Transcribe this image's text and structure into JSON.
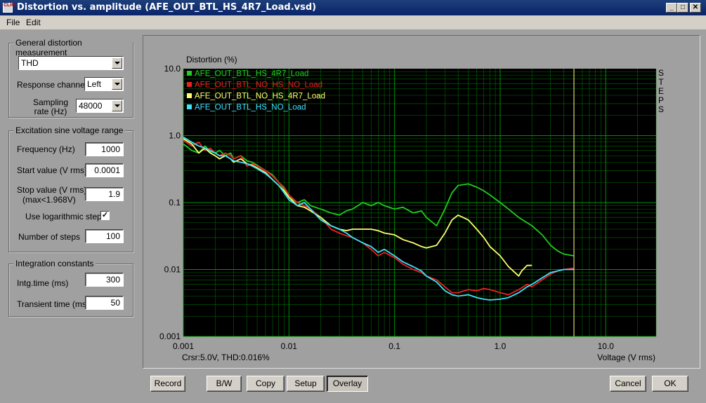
{
  "window": {
    "title": "Distortion vs. amplitude (AFE_OUT_BTL_HS_4R7_Load.vsd)",
    "icon_label": "CLIO",
    "controls": [
      "minimize-icon",
      "maximize-icon",
      "close-icon"
    ]
  },
  "menu": {
    "file": "File",
    "edit": "Edit"
  },
  "general": {
    "title": "General distortion measurement",
    "measurement": "THD",
    "response_channel_label": "Response channel",
    "response_channel": "Left",
    "sampling_label_1": "Sampling",
    "sampling_label_2": "rate (Hz)",
    "sampling_rate": "48000"
  },
  "excitation": {
    "title": "Excitation sine voltage range",
    "frequency_label": "Frequency (Hz)",
    "frequency": "1000",
    "start_label": "Start value (V rms)",
    "start": "0.0001",
    "stop_label_1": "Stop value (V rms)",
    "stop_label_2": "(max<1.968V)",
    "stop": "1.9",
    "log_label": "Use logarithmic steps",
    "log_checked": "✓",
    "steps_label": "Number of steps",
    "steps": "100"
  },
  "integration": {
    "title": "Integration constants",
    "intg_label": "Intg.time (ms)",
    "intg": "300",
    "transient_label": "Transient time (ms)",
    "transient": "50"
  },
  "buttons": {
    "record": "Record",
    "bw": "B/W",
    "copy": "Copy",
    "setup": "Setup",
    "overlay": "Overlay",
    "cancel": "Cancel",
    "ok": "OK"
  },
  "chart_data": {
    "type": "line",
    "ylabel": "Distortion (%)",
    "xlabel": "Voltage (V rms)",
    "x_scale": "log",
    "y_scale": "log",
    "xlim": [
      0.001,
      30
    ],
    "ylim": [
      0.001,
      10
    ],
    "x_ticks": [
      "0.001",
      "0.01",
      "0.1",
      "1.0",
      "10.0"
    ],
    "y_ticks": [
      "10.0",
      "1.0",
      "0.1",
      "0.01",
      "0.001"
    ],
    "right_label": "STEPS",
    "cursor_text": "Crsr:5.0V, THD:0.016%",
    "cursor_x": 5.0,
    "background": "#000000",
    "grid_color": "#00a000",
    "cursor_color": "#d8d860",
    "legend_position": "top-left",
    "series": [
      {
        "name": "AFE_OUT_BTL_HS_4R7_Load",
        "color": "#22cc22",
        "points": [
          [
            0.001,
            0.75
          ],
          [
            0.0012,
            0.6
          ],
          [
            0.0014,
            0.55
          ],
          [
            0.0016,
            0.7
          ],
          [
            0.0018,
            0.58
          ],
          [
            0.002,
            0.55
          ],
          [
            0.0022,
            0.6
          ],
          [
            0.0025,
            0.5
          ],
          [
            0.0028,
            0.55
          ],
          [
            0.003,
            0.45
          ],
          [
            0.0035,
            0.5
          ],
          [
            0.004,
            0.42
          ],
          [
            0.0045,
            0.4
          ],
          [
            0.005,
            0.36
          ],
          [
            0.006,
            0.3
          ],
          [
            0.007,
            0.26
          ],
          [
            0.008,
            0.2
          ],
          [
            0.009,
            0.16
          ],
          [
            0.01,
            0.12
          ],
          [
            0.012,
            0.1
          ],
          [
            0.014,
            0.11
          ],
          [
            0.016,
            0.09
          ],
          [
            0.02,
            0.08
          ],
          [
            0.025,
            0.07
          ],
          [
            0.03,
            0.065
          ],
          [
            0.035,
            0.075
          ],
          [
            0.04,
            0.08
          ],
          [
            0.05,
            0.1
          ],
          [
            0.06,
            0.09
          ],
          [
            0.07,
            0.1
          ],
          [
            0.08,
            0.09
          ],
          [
            0.1,
            0.08
          ],
          [
            0.12,
            0.085
          ],
          [
            0.15,
            0.07
          ],
          [
            0.18,
            0.075
          ],
          [
            0.2,
            0.06
          ],
          [
            0.25,
            0.045
          ],
          [
            0.3,
            0.08
          ],
          [
            0.35,
            0.14
          ],
          [
            0.4,
            0.18
          ],
          [
            0.5,
            0.19
          ],
          [
            0.6,
            0.17
          ],
          [
            0.7,
            0.15
          ],
          [
            0.8,
            0.13
          ],
          [
            1.0,
            0.1
          ],
          [
            1.2,
            0.08
          ],
          [
            1.5,
            0.06
          ],
          [
            1.8,
            0.05
          ],
          [
            2.0,
            0.045
          ],
          [
            2.5,
            0.033
          ],
          [
            3.0,
            0.023
          ],
          [
            3.5,
            0.019
          ],
          [
            4.0,
            0.017
          ],
          [
            5.0,
            0.016
          ]
        ]
      },
      {
        "name": "AFE_OUT_BTL_NO_HS_NO_Load",
        "color": "#ee2020",
        "points": [
          [
            0.001,
            0.85
          ],
          [
            0.0012,
            0.7
          ],
          [
            0.0014,
            0.8
          ],
          [
            0.0016,
            0.6
          ],
          [
            0.0018,
            0.65
          ],
          [
            0.002,
            0.55
          ],
          [
            0.0022,
            0.5
          ],
          [
            0.0025,
            0.55
          ],
          [
            0.0028,
            0.5
          ],
          [
            0.003,
            0.45
          ],
          [
            0.0035,
            0.5
          ],
          [
            0.004,
            0.35
          ],
          [
            0.0045,
            0.38
          ],
          [
            0.005,
            0.35
          ],
          [
            0.006,
            0.3
          ],
          [
            0.007,
            0.25
          ],
          [
            0.008,
            0.2
          ],
          [
            0.009,
            0.17
          ],
          [
            0.01,
            0.13
          ],
          [
            0.012,
            0.1
          ],
          [
            0.014,
            0.09
          ],
          [
            0.016,
            0.08
          ],
          [
            0.02,
            0.06
          ],
          [
            0.025,
            0.04
          ],
          [
            0.03,
            0.035
          ],
          [
            0.035,
            0.032
          ],
          [
            0.04,
            0.03
          ],
          [
            0.05,
            0.025
          ],
          [
            0.06,
            0.02
          ],
          [
            0.07,
            0.016
          ],
          [
            0.08,
            0.018
          ],
          [
            0.1,
            0.015
          ],
          [
            0.12,
            0.012
          ],
          [
            0.15,
            0.01
          ],
          [
            0.18,
            0.009
          ],
          [
            0.2,
            0.008
          ],
          [
            0.25,
            0.007
          ],
          [
            0.3,
            0.0055
          ],
          [
            0.35,
            0.0045
          ],
          [
            0.4,
            0.0045
          ],
          [
            0.5,
            0.005
          ],
          [
            0.6,
            0.0048
          ],
          [
            0.7,
            0.0052
          ],
          [
            0.8,
            0.005
          ],
          [
            1.0,
            0.0045
          ],
          [
            1.2,
            0.0042
          ],
          [
            1.5,
            0.005
          ],
          [
            1.8,
            0.006
          ],
          [
            2.0,
            0.0055
          ],
          [
            2.5,
            0.007
          ],
          [
            3.0,
            0.0085
          ],
          [
            3.5,
            0.0095
          ],
          [
            4.0,
            0.01
          ],
          [
            5.0,
            0.0105
          ]
        ]
      },
      {
        "name": "AFE_OUT_BTL_NO_HS_4R7_Load",
        "color": "#ffff70",
        "points": [
          [
            0.001,
            0.9
          ],
          [
            0.0012,
            0.75
          ],
          [
            0.0014,
            0.55
          ],
          [
            0.0016,
            0.65
          ],
          [
            0.0018,
            0.55
          ],
          [
            0.002,
            0.5
          ],
          [
            0.0022,
            0.45
          ],
          [
            0.0025,
            0.5
          ],
          [
            0.0028,
            0.45
          ],
          [
            0.003,
            0.4
          ],
          [
            0.0035,
            0.45
          ],
          [
            0.004,
            0.38
          ],
          [
            0.0045,
            0.36
          ],
          [
            0.005,
            0.33
          ],
          [
            0.006,
            0.28
          ],
          [
            0.007,
            0.22
          ],
          [
            0.008,
            0.18
          ],
          [
            0.009,
            0.15
          ],
          [
            0.01,
            0.12
          ],
          [
            0.012,
            0.09
          ],
          [
            0.014,
            0.085
          ],
          [
            0.016,
            0.075
          ],
          [
            0.02,
            0.06
          ],
          [
            0.025,
            0.045
          ],
          [
            0.03,
            0.04
          ],
          [
            0.035,
            0.038
          ],
          [
            0.04,
            0.04
          ],
          [
            0.05,
            0.04
          ],
          [
            0.06,
            0.04
          ],
          [
            0.07,
            0.038
          ],
          [
            0.08,
            0.035
          ],
          [
            0.1,
            0.033
          ],
          [
            0.12,
            0.028
          ],
          [
            0.15,
            0.025
          ],
          [
            0.18,
            0.022
          ],
          [
            0.2,
            0.021
          ],
          [
            0.25,
            0.023
          ],
          [
            0.3,
            0.035
          ],
          [
            0.35,
            0.055
          ],
          [
            0.4,
            0.065
          ],
          [
            0.5,
            0.055
          ],
          [
            0.6,
            0.04
          ],
          [
            0.7,
            0.03
          ],
          [
            0.8,
            0.022
          ],
          [
            1.0,
            0.016
          ],
          [
            1.2,
            0.011
          ],
          [
            1.5,
            0.008
          ],
          [
            1.6,
            0.0095
          ],
          [
            1.8,
            0.0115
          ],
          [
            2.0,
            0.0115
          ]
        ]
      },
      {
        "name": "AFE_OUT_BTL_HS_NO_Load",
        "color": "#40e0ff",
        "points": [
          [
            0.001,
            0.95
          ],
          [
            0.0012,
            0.8
          ],
          [
            0.0014,
            0.7
          ],
          [
            0.0016,
            0.65
          ],
          [
            0.0018,
            0.6
          ],
          [
            0.002,
            0.55
          ],
          [
            0.0022,
            0.5
          ],
          [
            0.0025,
            0.5
          ],
          [
            0.0028,
            0.45
          ],
          [
            0.003,
            0.42
          ],
          [
            0.0035,
            0.4
          ],
          [
            0.004,
            0.38
          ],
          [
            0.0045,
            0.35
          ],
          [
            0.005,
            0.32
          ],
          [
            0.006,
            0.27
          ],
          [
            0.007,
            0.22
          ],
          [
            0.008,
            0.18
          ],
          [
            0.009,
            0.14
          ],
          [
            0.01,
            0.11
          ],
          [
            0.012,
            0.09
          ],
          [
            0.014,
            0.1
          ],
          [
            0.016,
            0.08
          ],
          [
            0.02,
            0.055
          ],
          [
            0.025,
            0.045
          ],
          [
            0.03,
            0.04
          ],
          [
            0.035,
            0.035
          ],
          [
            0.04,
            0.03
          ],
          [
            0.05,
            0.025
          ],
          [
            0.06,
            0.022
          ],
          [
            0.07,
            0.018
          ],
          [
            0.08,
            0.02
          ],
          [
            0.1,
            0.016
          ],
          [
            0.12,
            0.013
          ],
          [
            0.15,
            0.011
          ],
          [
            0.18,
            0.0095
          ],
          [
            0.2,
            0.008
          ],
          [
            0.25,
            0.0065
          ],
          [
            0.3,
            0.0048
          ],
          [
            0.35,
            0.0042
          ],
          [
            0.4,
            0.004
          ],
          [
            0.5,
            0.0042
          ],
          [
            0.6,
            0.0038
          ],
          [
            0.7,
            0.0036
          ],
          [
            0.8,
            0.0035
          ],
          [
            1.0,
            0.0036
          ],
          [
            1.2,
            0.0038
          ],
          [
            1.5,
            0.0045
          ],
          [
            1.8,
            0.0055
          ],
          [
            2.0,
            0.006
          ],
          [
            2.5,
            0.0075
          ],
          [
            3.0,
            0.009
          ],
          [
            3.5,
            0.0095
          ],
          [
            4.0,
            0.01
          ],
          [
            5.0,
            0.01
          ]
        ]
      }
    ]
  }
}
